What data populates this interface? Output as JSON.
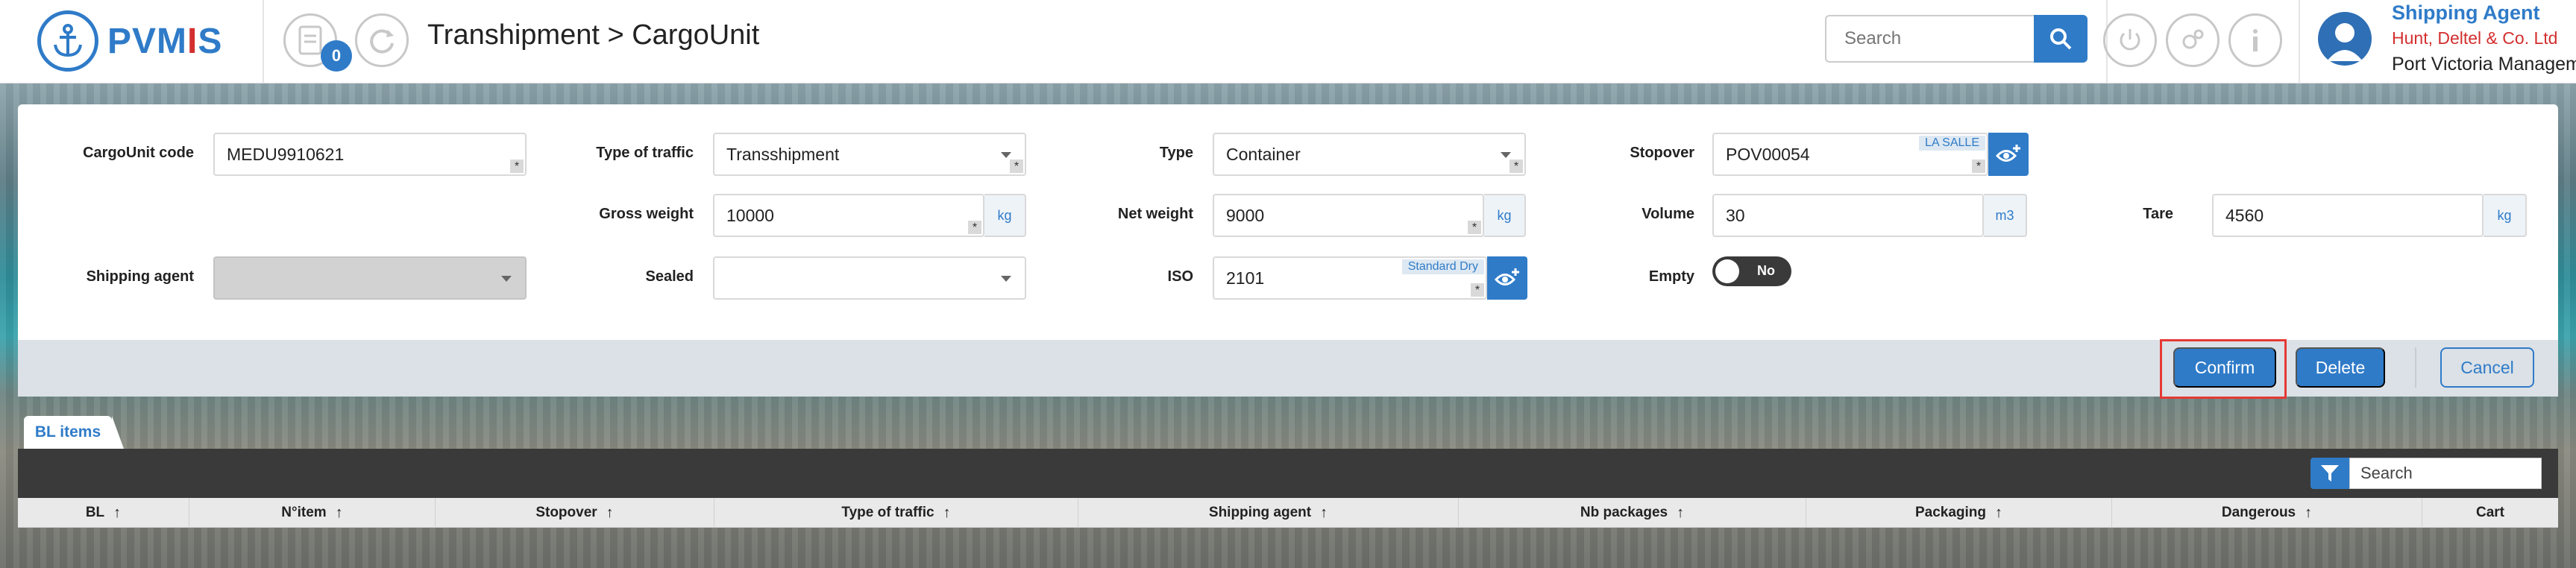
{
  "header": {
    "logo_prefix": "PVM",
    "logo_accent": "I",
    "logo_suffix": "S",
    "notification_count": "0",
    "title": "Transhipment > CargoUnit",
    "search_placeholder": "Search",
    "user": {
      "role": "Shipping Agent",
      "company": "Hunt, Deltel & Co. Ltd",
      "organization": "Port Victoria Managem"
    }
  },
  "form": {
    "cargo_code": {
      "label": "CargoUnit code",
      "value": "MEDU9910621"
    },
    "type_of_traffic": {
      "label": "Type of traffic",
      "value": "Transshipment"
    },
    "type": {
      "label": "Type",
      "value": "Container"
    },
    "stopover": {
      "label": "Stopover",
      "value": "POV00054",
      "tag": "LA SALLE"
    },
    "gross_weight": {
      "label": "Gross weight",
      "value": "10000",
      "unit": "kg"
    },
    "net_weight": {
      "label": "Net weight",
      "value": "9000",
      "unit": "kg"
    },
    "volume": {
      "label": "Volume",
      "value": "30",
      "unit": "m3"
    },
    "tare": {
      "label": "Tare",
      "value": "4560",
      "unit": "kg"
    },
    "shipping_agent": {
      "label": "Shipping agent",
      "value": ""
    },
    "sealed": {
      "label": "Sealed",
      "value": ""
    },
    "iso": {
      "label": "ISO",
      "value": "2101",
      "tag": "Standard Dry"
    },
    "empty": {
      "label": "Empty",
      "toggle_text": "No"
    },
    "required_mark": "*"
  },
  "actions": {
    "confirm": "Confirm",
    "delete": "Delete",
    "cancel": "Cancel"
  },
  "bl_items": {
    "tab_label": "BL items",
    "search_placeholder": "Search",
    "columns": [
      "BL",
      "N°item",
      "Stopover",
      "Type of traffic",
      "Shipping agent",
      "Nb packages",
      "Packaging",
      "Dangerous",
      "Cart"
    ],
    "sort_arrow": "↑"
  },
  "colors": {
    "primary": "#2f7bc8",
    "accent_red": "#d32f2f",
    "highlight": "#e53935"
  }
}
